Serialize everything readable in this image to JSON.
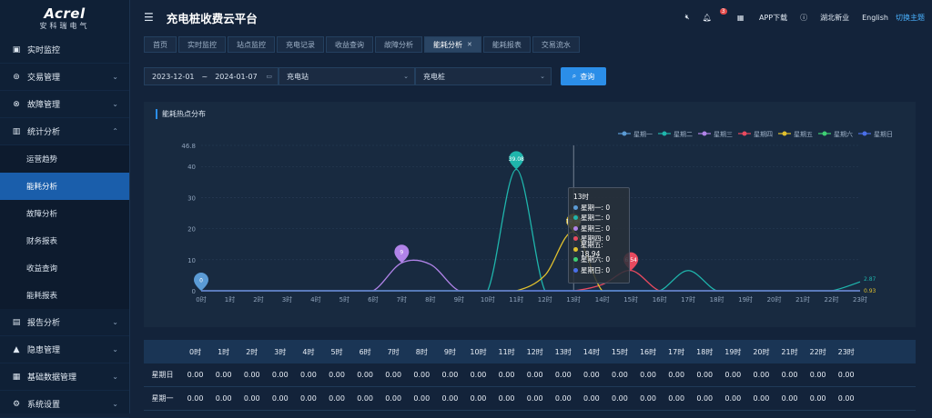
{
  "app": {
    "brand": "Acrel",
    "brand_sub": "安科瑞电气",
    "title": "充电桩收费云平台"
  },
  "header_right": {
    "mute_icon": "volume-mute-icon",
    "bell_count": "3",
    "app_download": "APP下载",
    "help_icon": "question-icon",
    "location": "湖北新业",
    "language": "English",
    "switch_theme": "切换主题"
  },
  "sidebar": {
    "items": [
      {
        "label": "实时监控",
        "icon": "monitor-icon",
        "chevron": ""
      },
      {
        "label": "交易管理",
        "icon": "coin-icon",
        "chevron": "⌄"
      },
      {
        "label": "故障管理",
        "icon": "fault-icon",
        "chevron": "⌄"
      },
      {
        "label": "统计分析",
        "icon": "bar-chart-icon",
        "chevron": "⌃"
      }
    ],
    "sub_items": [
      {
        "label": "运营趋势"
      },
      {
        "label": "能耗分析"
      },
      {
        "label": "故障分析"
      },
      {
        "label": "财务报表"
      },
      {
        "label": "收益查询"
      },
      {
        "label": "能耗报表"
      }
    ],
    "items_after": [
      {
        "label": "报告分析",
        "icon": "report-icon",
        "chevron": "⌄"
      },
      {
        "label": "隐患管理",
        "icon": "warning-icon",
        "chevron": "⌄"
      },
      {
        "label": "基础数据管理",
        "icon": "database-icon",
        "chevron": "⌄"
      },
      {
        "label": "系统设置",
        "icon": "settings-icon",
        "chevron": "⌄"
      }
    ]
  },
  "tabs": [
    {
      "label": "首页"
    },
    {
      "label": "实时监控"
    },
    {
      "label": "站点监控"
    },
    {
      "label": "充电记录"
    },
    {
      "label": "收益查询"
    },
    {
      "label": "故障分析"
    },
    {
      "label": "能耗分析"
    },
    {
      "label": "能耗报表"
    },
    {
      "label": "交易流水"
    }
  ],
  "filter": {
    "date_start": "2023-12-01",
    "date_sep": "~",
    "date_end": "2024-01-07",
    "station": "充电站",
    "pile": "充电桩",
    "query": "查询"
  },
  "chart_title": "能耗热点分布",
  "chart_data": {
    "type": "line",
    "title": "能耗热点分布",
    "x": [
      "0时",
      "1时",
      "2时",
      "3时",
      "4时",
      "5时",
      "6时",
      "7时",
      "8时",
      "9时",
      "10时",
      "11时",
      "12时",
      "13时",
      "14时",
      "15时",
      "16时",
      "17时",
      "18时",
      "19时",
      "20时",
      "21时",
      "22时",
      "23时"
    ],
    "ylim": [
      0,
      46.8
    ],
    "yticks": [
      0,
      10,
      20,
      30,
      40,
      46.8
    ],
    "legend": "top-right",
    "series": [
      {
        "name": "星期一",
        "color": "#5b9bd5",
        "values": [
          0,
          0,
          0,
          0,
          0,
          0,
          0,
          0,
          0,
          0,
          0,
          0,
          0,
          0,
          0,
          0,
          0,
          0,
          0,
          0,
          0,
          0,
          0,
          0
        ]
      },
      {
        "name": "星期二",
        "color": "#1fb5ac",
        "values": [
          0,
          0,
          0,
          0,
          0,
          0,
          0,
          0,
          0,
          0,
          0,
          39.08,
          0,
          0,
          0,
          0,
          0,
          6.5,
          0,
          0,
          0,
          0,
          0,
          2.87
        ]
      },
      {
        "name": "星期三",
        "color": "#b083e8",
        "values": [
          0,
          0,
          0,
          0,
          0,
          0,
          0,
          9,
          8.5,
          0,
          0,
          0,
          0,
          0,
          0,
          0,
          0,
          0,
          0,
          0,
          0,
          0,
          0,
          0
        ]
      },
      {
        "name": "星期四",
        "color": "#e84a5f",
        "values": [
          0,
          0,
          0,
          0,
          0,
          0,
          0,
          0,
          0,
          0,
          0,
          0,
          0,
          0,
          2,
          6.54,
          0,
          0,
          0,
          0,
          0,
          0,
          0,
          0
        ]
      },
      {
        "name": "星期五",
        "color": "#e0c02e",
        "values": [
          0,
          0,
          0,
          0,
          0,
          0,
          0,
          0,
          0,
          0,
          0,
          0,
          5,
          18.94,
          0,
          0,
          0,
          0,
          0,
          0,
          0,
          0,
          0,
          0
        ]
      },
      {
        "name": "星期六",
        "color": "#3ecf74",
        "values": [
          0,
          0,
          0,
          0,
          0,
          0,
          0,
          0,
          0,
          0,
          0,
          0,
          0,
          0,
          0,
          0,
          0,
          0,
          0,
          0,
          0,
          0,
          0,
          0
        ]
      },
      {
        "name": "星期日",
        "color": "#4a6fe8",
        "values": [
          0,
          0,
          0,
          0,
          0,
          0,
          0,
          0,
          0,
          0,
          0,
          0,
          0,
          0,
          0,
          0,
          0,
          0,
          0,
          0,
          0,
          0,
          0,
          0
        ]
      }
    ],
    "markers": [
      {
        "series": "星期一",
        "x": "0时",
        "label": "0"
      },
      {
        "series": "星期三",
        "x": "7时",
        "label": "9"
      },
      {
        "series": "星期二",
        "x": "11时",
        "label": "39.08"
      },
      {
        "series": "星期四",
        "x": "15时",
        "label": "6.54"
      },
      {
        "series": "星期五",
        "x": "13时",
        "label": "18.94"
      }
    ],
    "end_labels": [
      "2.87",
      "0.93"
    ],
    "tooltip": {
      "title": "13时",
      "rows": [
        {
          "label": "星期一: 0",
          "color": "#5b9bd5"
        },
        {
          "label": "星期二: 0",
          "color": "#1fb5ac"
        },
        {
          "label": "星期三: 0",
          "color": "#b083e8"
        },
        {
          "label": "星期四: 0",
          "color": "#e84a5f"
        },
        {
          "label": "星期五: 18.94",
          "color": "#e0c02e"
        },
        {
          "label": "星期六: 0",
          "color": "#3ecf74"
        },
        {
          "label": "星期日: 0",
          "color": "#4a6fe8"
        }
      ]
    }
  },
  "table": {
    "headers": [
      "",
      "0时",
      "1时",
      "2时",
      "3时",
      "4时",
      "5时",
      "6时",
      "7时",
      "8时",
      "9时",
      "10时",
      "11时",
      "12时",
      "13时",
      "14时",
      "15时",
      "16时",
      "17时",
      "18时",
      "19时",
      "20时",
      "21时",
      "22时",
      "23时"
    ],
    "rows": [
      [
        "星期日",
        "0.00",
        "0.00",
        "0.00",
        "0.00",
        "0.00",
        "0.00",
        "0.00",
        "0.00",
        "0.00",
        "0.00",
        "0.00",
        "0.00",
        "0.00",
        "0.00",
        "0.00",
        "0.00",
        "0.00",
        "0.00",
        "0.00",
        "0.00",
        "0.00",
        "0.00",
        "0.00",
        "0.00"
      ],
      [
        "星期一",
        "0.00",
        "0.00",
        "0.00",
        "0.00",
        "0.00",
        "0.00",
        "0.00",
        "0.00",
        "0.00",
        "0.00",
        "0.00",
        "0.00",
        "0.00",
        "0.00",
        "0.00",
        "0.00",
        "0.00",
        "0.00",
        "0.00",
        "0.00",
        "0.00",
        "0.00",
        "0.00",
        "0.00"
      ]
    ]
  }
}
